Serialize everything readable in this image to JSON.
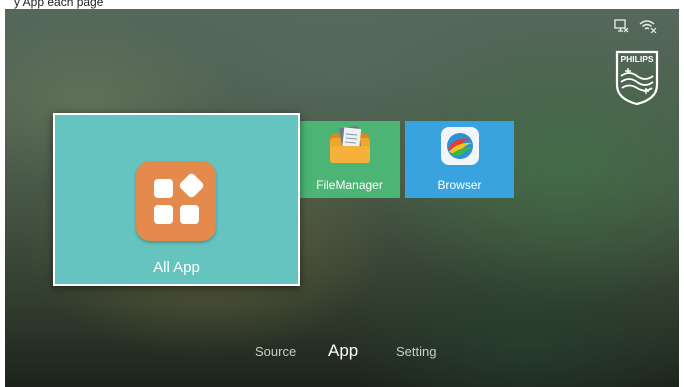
{
  "caption": "y App each page",
  "status_icons": [
    "network-icon",
    "wifi-disconnected-icon"
  ],
  "brand": {
    "logo": "PHILIPS"
  },
  "tiles": {
    "all_app": {
      "label": "All App",
      "icon": "apps-grid-icon",
      "color": "#66c4c0"
    },
    "file_manager": {
      "label": "FileManager",
      "icon": "folder-document-icon",
      "color": "#4cb575"
    },
    "browser": {
      "label": "Browser",
      "icon": "browser-globe-icon",
      "color": "#38a3de"
    }
  },
  "nav": {
    "items": [
      {
        "label": "Source"
      },
      {
        "label": "App"
      },
      {
        "label": "Setting"
      }
    ],
    "active": "App"
  }
}
